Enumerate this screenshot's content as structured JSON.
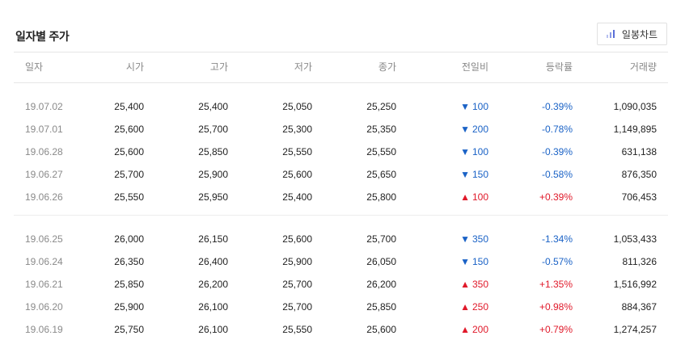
{
  "title": "일자별 주가",
  "chart_button": {
    "label": "일봉차트",
    "icon": "bar-chart-icon"
  },
  "columns": [
    "일자",
    "시가",
    "고가",
    "저가",
    "종가",
    "전일비",
    "등락률",
    "거래량"
  ],
  "colors": {
    "down": "#1a62c6",
    "up": "#e0192a"
  },
  "groups": [
    {
      "rows": [
        {
          "date": "19.07.02",
          "open": "25,400",
          "high": "25,400",
          "low": "25,050",
          "close": "25,250",
          "dir": "down",
          "arrow": "▼",
          "change": "100",
          "rate": "-0.39%",
          "volume": "1,090,035"
        },
        {
          "date": "19.07.01",
          "open": "25,600",
          "high": "25,700",
          "low": "25,300",
          "close": "25,350",
          "dir": "down",
          "arrow": "▼",
          "change": "200",
          "rate": "-0.78%",
          "volume": "1,149,895"
        },
        {
          "date": "19.06.28",
          "open": "25,600",
          "high": "25,850",
          "low": "25,550",
          "close": "25,550",
          "dir": "down",
          "arrow": "▼",
          "change": "100",
          "rate": "-0.39%",
          "volume": "631,138"
        },
        {
          "date": "19.06.27",
          "open": "25,700",
          "high": "25,900",
          "low": "25,600",
          "close": "25,650",
          "dir": "down",
          "arrow": "▼",
          "change": "150",
          "rate": "-0.58%",
          "volume": "876,350"
        },
        {
          "date": "19.06.26",
          "open": "25,550",
          "high": "25,950",
          "low": "25,400",
          "close": "25,800",
          "dir": "up",
          "arrow": "▲",
          "change": "100",
          "rate": "+0.39%",
          "volume": "706,453"
        }
      ]
    },
    {
      "rows": [
        {
          "date": "19.06.25",
          "open": "26,000",
          "high": "26,150",
          "low": "25,600",
          "close": "25,700",
          "dir": "down",
          "arrow": "▼",
          "change": "350",
          "rate": "-1.34%",
          "volume": "1,053,433"
        },
        {
          "date": "19.06.24",
          "open": "26,350",
          "high": "26,400",
          "low": "25,900",
          "close": "26,050",
          "dir": "down",
          "arrow": "▼",
          "change": "150",
          "rate": "-0.57%",
          "volume": "811,326"
        },
        {
          "date": "19.06.21",
          "open": "25,850",
          "high": "26,200",
          "low": "25,700",
          "close": "26,200",
          "dir": "up",
          "arrow": "▲",
          "change": "350",
          "rate": "+1.35%",
          "volume": "1,516,992"
        },
        {
          "date": "19.06.20",
          "open": "25,900",
          "high": "26,100",
          "low": "25,700",
          "close": "25,850",
          "dir": "up",
          "arrow": "▲",
          "change": "250",
          "rate": "+0.98%",
          "volume": "884,367"
        },
        {
          "date": "19.06.19",
          "open": "25,750",
          "high": "26,100",
          "low": "25,550",
          "close": "25,600",
          "dir": "up",
          "arrow": "▲",
          "change": "200",
          "rate": "+0.79%",
          "volume": "1,274,257"
        }
      ]
    }
  ]
}
